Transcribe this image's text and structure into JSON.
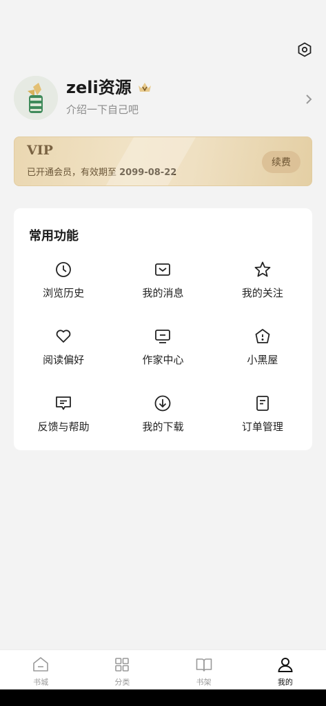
{
  "header": {
    "settings_icon": "settings-hexagon-icon"
  },
  "profile": {
    "username": "zeli资源",
    "bio": "介绍一下自己吧",
    "badge_icon": "vip-crown-icon"
  },
  "vip": {
    "title": "VIP",
    "status_prefix": "已开通会员，有效期至 ",
    "expiry": "2099-08-22",
    "renew_label": "续费"
  },
  "functions": {
    "title": "常用功能",
    "items": [
      {
        "label": "浏览历史",
        "icon": "clock-icon"
      },
      {
        "label": "我的消息",
        "icon": "message-icon"
      },
      {
        "label": "我的关注",
        "icon": "star-icon"
      },
      {
        "label": "阅读偏好",
        "icon": "heart-icon"
      },
      {
        "label": "作家中心",
        "icon": "monitor-icon"
      },
      {
        "label": "小黑屋",
        "icon": "house-icon"
      },
      {
        "label": "反馈与帮助",
        "icon": "feedback-icon"
      },
      {
        "label": "我的下载",
        "icon": "download-icon"
      },
      {
        "label": "订单管理",
        "icon": "document-icon"
      }
    ]
  },
  "tabbar": {
    "items": [
      {
        "label": "书城",
        "icon": "home-icon"
      },
      {
        "label": "分类",
        "icon": "grid-icon"
      },
      {
        "label": "书架",
        "icon": "book-icon"
      },
      {
        "label": "我的",
        "icon": "user-icon"
      }
    ],
    "active_index": 3
  },
  "colors": {
    "vip_gold": "#e9d6b0",
    "vip_text": "#7a6343",
    "renew_bg": "#dcc197"
  }
}
